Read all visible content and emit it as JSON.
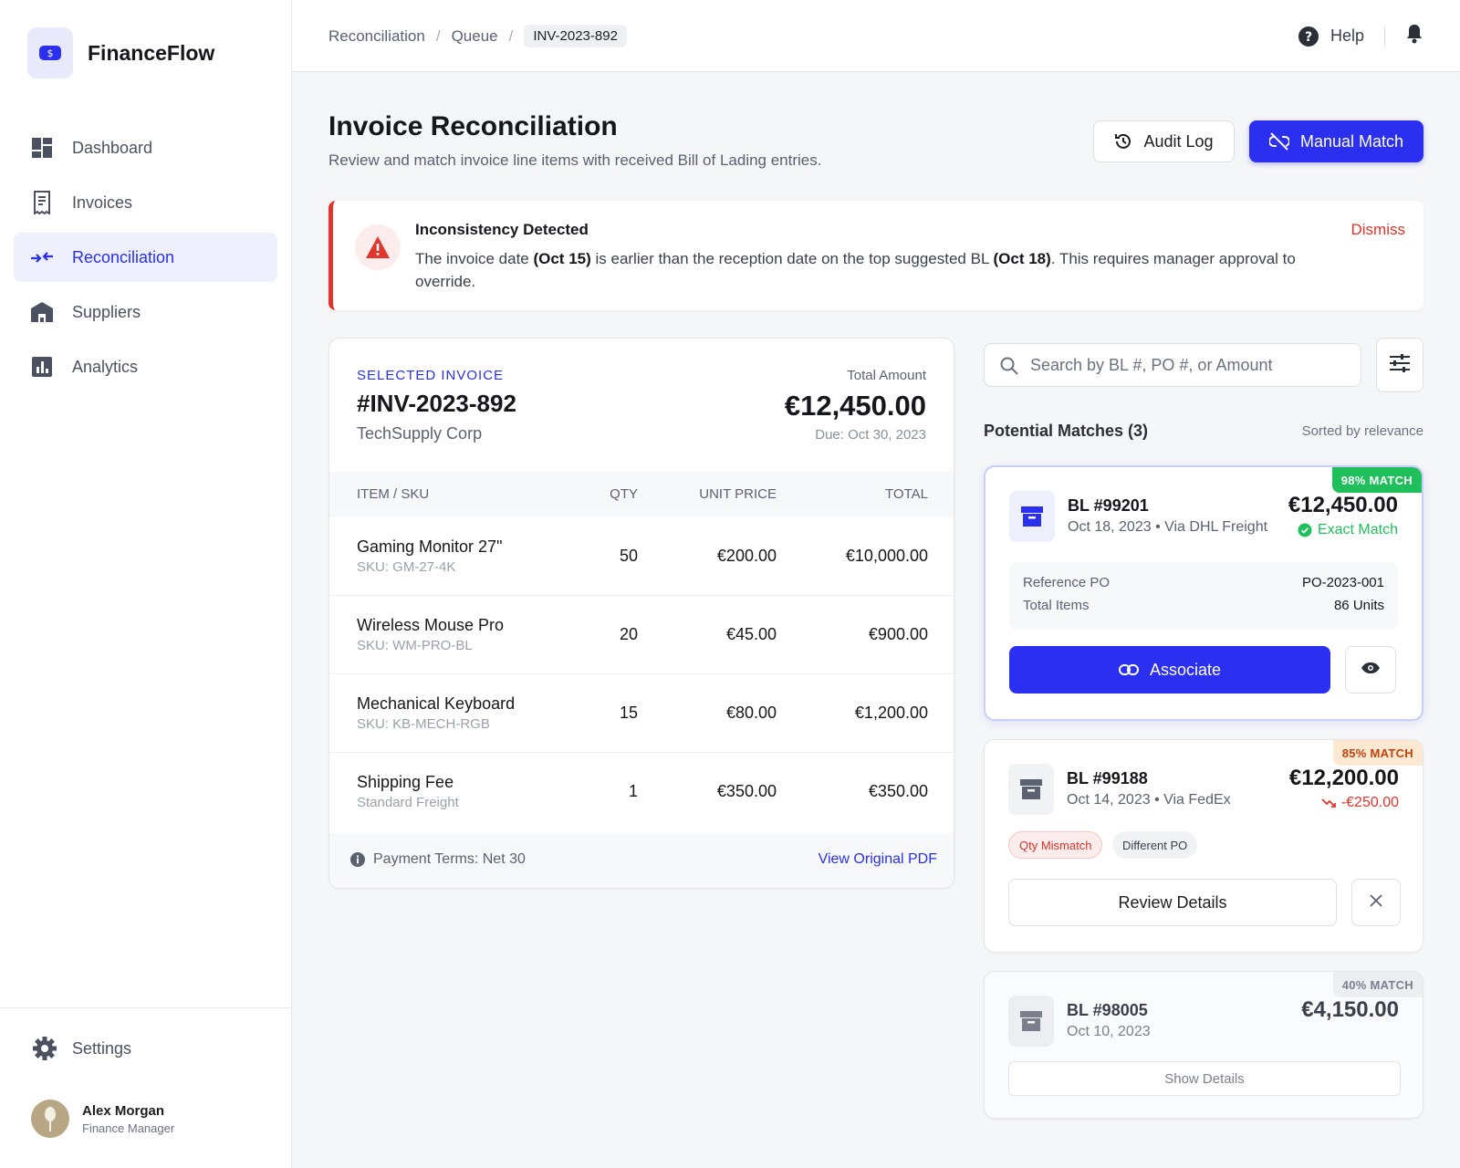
{
  "app": {
    "name": "FinanceFlow",
    "logo_symbol": "$"
  },
  "sidebar": {
    "items": [
      {
        "label": "Dashboard",
        "icon": "dashboard-icon",
        "active": false
      },
      {
        "label": "Invoices",
        "icon": "receipt-icon",
        "active": false
      },
      {
        "label": "Reconciliation",
        "icon": "compare-arrows-icon",
        "active": true
      },
      {
        "label": "Suppliers",
        "icon": "warehouse-icon",
        "active": false
      },
      {
        "label": "Analytics",
        "icon": "bar-chart-icon",
        "active": false
      }
    ],
    "settings_label": "Settings",
    "user": {
      "name": "Alex Morgan",
      "role": "Finance Manager"
    }
  },
  "topbar": {
    "breadcrumb": [
      "Reconciliation",
      "Queue",
      "INV-2023-892"
    ],
    "help_label": "Help"
  },
  "header": {
    "title": "Invoice Reconciliation",
    "subtitle": "Review and match invoice line items with received Bill of Lading entries.",
    "audit_label": "Audit Log",
    "manual_label": "Manual Match"
  },
  "alert": {
    "title": "Inconsistency Detected",
    "text_1": "The invoice date ",
    "bold_1": "(Oct 15)",
    "text_2": " is earlier than the reception date on the top suggested BL ",
    "bold_2": "(Oct 18)",
    "text_3": ". This requires manager approval to override.",
    "dismiss_label": "Dismiss"
  },
  "invoice": {
    "label": "SELECTED INVOICE",
    "number": "#INV-2023-892",
    "supplier": "TechSupply Corp",
    "total_label": "Total Amount",
    "total": "€12,450.00",
    "due": "Due: Oct 30, 2023",
    "columns": [
      "ITEM / SKU",
      "QTY",
      "UNIT PRICE",
      "TOTAL"
    ],
    "rows": [
      {
        "name": "Gaming Monitor 27\"",
        "sku": "SKU: GM-27-4K",
        "qty": "50",
        "unit": "€200.00",
        "total": "€10,000.00"
      },
      {
        "name": "Wireless Mouse Pro",
        "sku": "SKU: WM-PRO-BL",
        "qty": "20",
        "unit": "€45.00",
        "total": "€900.00"
      },
      {
        "name": "Mechanical Keyboard",
        "sku": "SKU: KB-MECH-RGB",
        "qty": "15",
        "unit": "€80.00",
        "total": "€1,200.00"
      },
      {
        "name": "Shipping Fee",
        "sku": "Standard Freight",
        "qty": "1",
        "unit": "€350.00",
        "total": "€350.00"
      }
    ],
    "terms": "Payment Terms: Net 30",
    "pdf_label": "View Original PDF"
  },
  "matches_panel": {
    "search_placeholder": "Search by BL #, PO #, or Amount",
    "title": "Potential Matches (3)",
    "sort": "Sorted by relevance",
    "matches": [
      {
        "badge": "98% MATCH",
        "bl": "BL #99201",
        "meta": "Oct 18, 2023 • Via DHL Freight",
        "amount": "€12,450.00",
        "status": "Exact Match",
        "ref_po_label": "Reference PO",
        "ref_po": "PO-2023-001",
        "items_label": "Total Items",
        "items": "86 Units",
        "action": "Associate"
      },
      {
        "badge": "85% MATCH",
        "bl": "BL #99188",
        "meta": "Oct 14, 2023 • Via FedEx",
        "amount": "€12,200.00",
        "diff": "-€250.00",
        "tags": [
          "Qty Mismatch",
          "Different PO"
        ],
        "action": "Review Details"
      },
      {
        "badge": "40% MATCH",
        "bl": "BL #98005",
        "meta": "Oct 10, 2023",
        "amount": "€4,150.00",
        "action": "Show Details"
      }
    ]
  },
  "colors": {
    "accent": "#2a2ff0",
    "danger": "#e0342c",
    "success": "#1fbf5b",
    "warning_bg": "#fde8d2"
  }
}
